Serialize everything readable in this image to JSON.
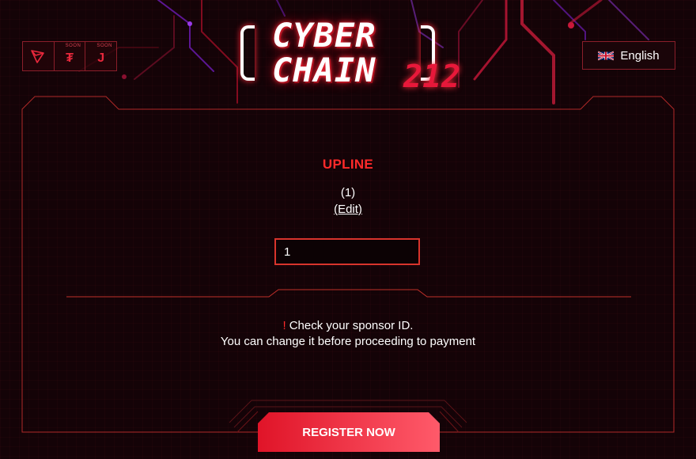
{
  "header": {
    "logo": {
      "line1": "CYBER",
      "line2": "CHAIN",
      "suffix": "212"
    },
    "tokens": [
      {
        "icon": "tron-icon",
        "glyph": "",
        "badge": ""
      },
      {
        "icon": "tether-icon",
        "glyph": "₮",
        "badge": "SOON"
      },
      {
        "icon": "j-token-icon",
        "glyph": "J",
        "badge": "SOON"
      }
    ],
    "language": {
      "label": "English",
      "icon": "uk-flag-icon"
    }
  },
  "upline": {
    "title": "UPLINE",
    "id_display": "(1)",
    "edit_label": "(Edit)",
    "input_value": "1"
  },
  "message": {
    "warning_mark": "!",
    "line1": "Check your sponsor ID.",
    "line2": "You can change it before proceeding to payment"
  },
  "actions": {
    "register_label": "REGISTER NOW"
  },
  "colors": {
    "accent": "#ff2a2a",
    "panel_border": "#c0302a",
    "background": "#140307"
  }
}
